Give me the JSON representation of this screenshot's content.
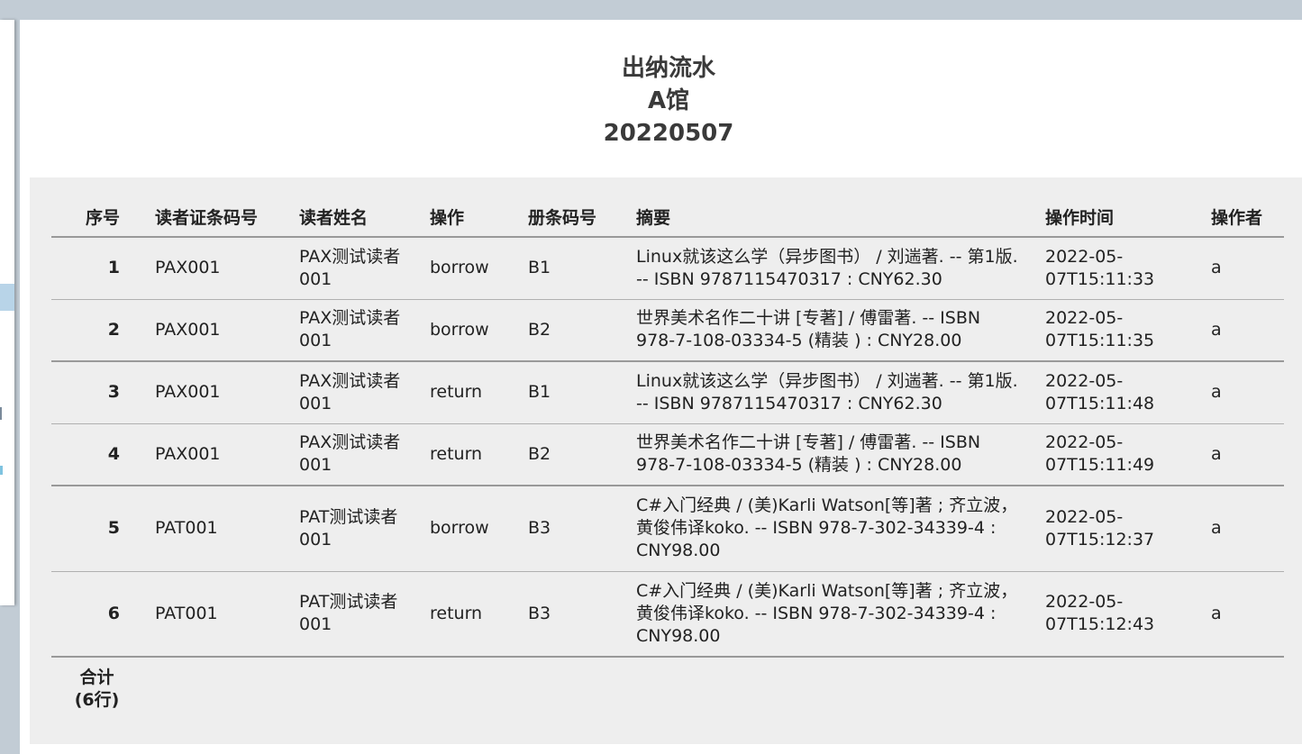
{
  "report": {
    "title": "出纳流水",
    "library": "A馆",
    "date": "20220507"
  },
  "table": {
    "columns": [
      "序号",
      "读者证条码号",
      "读者姓名",
      "操作",
      "册条码号",
      "摘要",
      "操作时间",
      "操作者"
    ],
    "rows": [
      {
        "index": "1",
        "card": "PAX001",
        "name": "PAX测试读者001",
        "op": "borrow",
        "item": "B1",
        "summary": "Linux就该这么学（异步图书） / 刘遄著. -- 第1版. -- ISBN 9787115470317 : CNY62.30",
        "time": "2022-05-07T15:11:33",
        "operator": "a"
      },
      {
        "index": "2",
        "card": "PAX001",
        "name": "PAX测试读者001",
        "op": "borrow",
        "item": "B2",
        "summary": "世界美术名作二十讲 [专著] / 傅雷著. -- ISBN 978-7-108-03334-5 (精装 ) : CNY28.00",
        "time": "2022-05-07T15:11:35",
        "operator": "a"
      },
      {
        "index": "3",
        "card": "PAX001",
        "name": "PAX测试读者001",
        "op": "return",
        "item": "B1",
        "summary": "Linux就该这么学（异步图书） / 刘遄著. -- 第1版. -- ISBN 9787115470317 : CNY62.30",
        "time": "2022-05-07T15:11:48",
        "operator": "a"
      },
      {
        "index": "4",
        "card": "PAX001",
        "name": "PAX测试读者001",
        "op": "return",
        "item": "B2",
        "summary": "世界美术名作二十讲 [专著] / 傅雷著. -- ISBN 978-7-108-03334-5 (精装 ) : CNY28.00",
        "time": "2022-05-07T15:11:49",
        "operator": "a"
      },
      {
        "index": "5",
        "card": "PAT001",
        "name": "PAT测试读者001",
        "op": "borrow",
        "item": "B3",
        "summary": "C#入门经典 / (美)Karli Watson[等]著 ; 齐立波，黄俊伟译koko. -- ISBN 978-7-302-34339-4 : CNY98.00",
        "time": "2022-05-07T15:12:37",
        "operator": "a"
      },
      {
        "index": "6",
        "card": "PAT001",
        "name": "PAT测试读者001",
        "op": "return",
        "item": "B3",
        "summary": "C#入门经典 / (美)Karli Watson[等]著 ; 齐立波，黄俊伟译koko. -- ISBN 978-7-302-34339-4 : CNY98.00",
        "time": "2022-05-07T15:12:43",
        "operator": "a"
      }
    ],
    "total_label": "合计",
    "total_count": "(6行)"
  }
}
